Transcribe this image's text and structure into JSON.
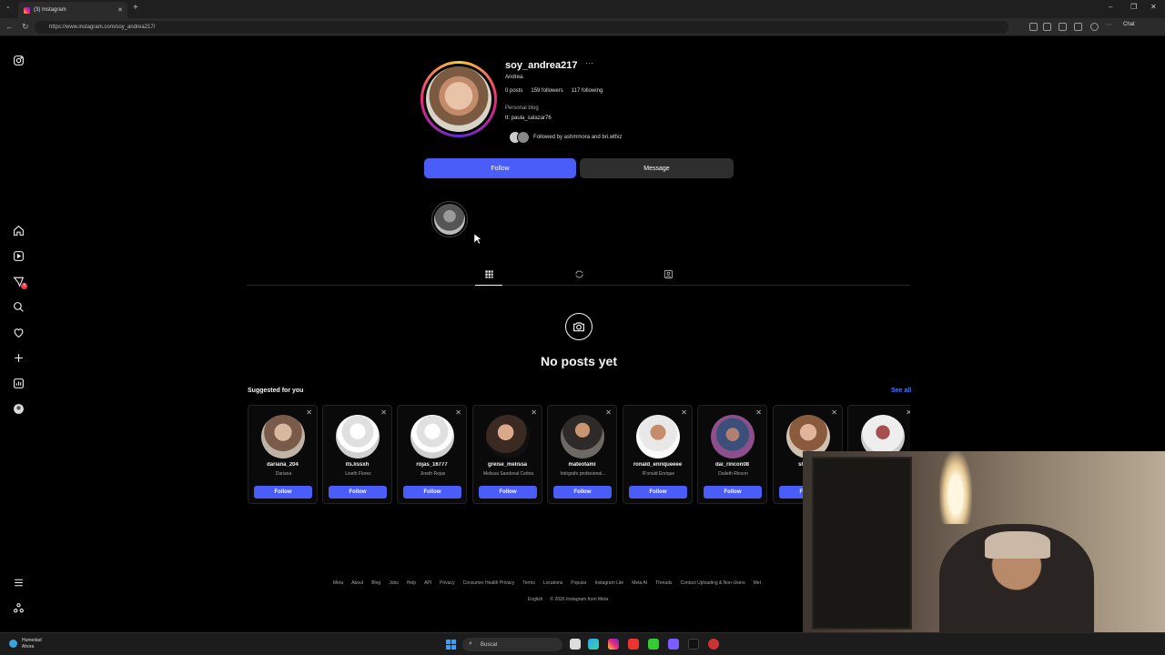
{
  "browser": {
    "tab_title": "(3) Instagram",
    "url": "https://www.instagram.com/soy_andrea217/",
    "chat_label": "Chat"
  },
  "profile": {
    "username": "soy_andrea217",
    "full_name": "Andrea.",
    "posts": "0 posts",
    "followers": "159 followers",
    "following": "117 following",
    "category": "Personal blog",
    "bio": "tt: paula_salazar76",
    "followed_by": "Followed by ashmmora and bri.wtfxz",
    "follow_label": "Follow",
    "message_label": "Message"
  },
  "empty_state": {
    "title": "No posts yet"
  },
  "suggestions": {
    "title": "Suggested for you",
    "see_all": "See all",
    "follow_label": "Follow",
    "items": [
      {
        "username": "dariana_204",
        "name": "Dariana"
      },
      {
        "username": "its.lissxh",
        "name": "Liseth Florez"
      },
      {
        "username": "rojas_16777",
        "name": "Jineth Rojas"
      },
      {
        "username": "greise_melissa",
        "name": "Melissa Sandoval Cetina"
      },
      {
        "username": "mateotami",
        "name": "fotógrafo profesional..."
      },
      {
        "username": "ronald_enriqueeee",
        "name": "R'onald Enrique"
      },
      {
        "username": "dai_rincon08",
        "name": "Daileth Rincon"
      },
      {
        "username": "sharik_",
        "name": ""
      },
      {
        "username": "",
        "name": ""
      }
    ]
  },
  "footer": {
    "links": [
      "Meta",
      "About",
      "Blog",
      "Jobs",
      "Help",
      "API",
      "Privacy",
      "Consumer Health Privacy",
      "Terms",
      "Locations",
      "Popular",
      "Instagram Lite",
      "Meta AI",
      "Threads",
      "Contact Uploading & Non-Users",
      "Met"
    ],
    "language": "English",
    "copyright": "© 2026 Instagram from Meta"
  },
  "taskbar": {
    "weather_title": "Humedad",
    "weather_sub": "Ahora",
    "search_placeholder": "Buscar"
  },
  "sidebar_badge": "3",
  "colors": {
    "primary_button": "#4a5df9",
    "secondary_button": "#2e2e2e",
    "link": "#4a7cf9",
    "background": "#000000"
  }
}
